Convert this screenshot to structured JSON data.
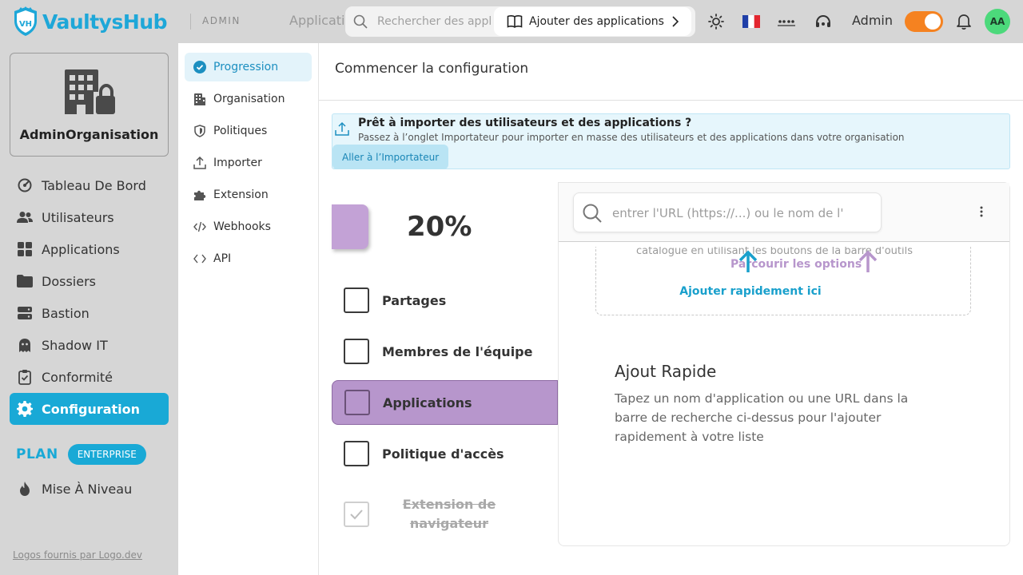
{
  "app": {
    "name": "VaultysHub",
    "logo_initials": "VH",
    "section": "ADMIN",
    "nav_ghost": "Applicati"
  },
  "topbar": {
    "search_placeholder": "Rechercher des appl",
    "add_apps_label": "Ajouter des applications",
    "user_name": "Admin",
    "avatar_initials": "AA",
    "flag": "🇫🇷"
  },
  "org": {
    "name": "AdminOrganisation"
  },
  "sidebar": {
    "items": [
      {
        "label": "Tableau De Bord",
        "icon": "dashboard-icon"
      },
      {
        "label": "Utilisateurs",
        "icon": "users-icon"
      },
      {
        "label": "Applications",
        "icon": "grid-icon"
      },
      {
        "label": "Dossiers",
        "icon": "folder-icon"
      },
      {
        "label": "Bastion",
        "icon": "server-icon"
      },
      {
        "label": "Shadow IT",
        "icon": "ghost-icon"
      },
      {
        "label": "Conformité",
        "icon": "clipboard-icon"
      },
      {
        "label": "Configuration",
        "icon": "gear-icon",
        "active": true
      }
    ],
    "plan_label": "PLAN",
    "plan_badge": "ENTERPRISE",
    "upgrade_label": "Mise À Niveau",
    "footer_link": "Logos fournis par Logo.dev"
  },
  "subnav": {
    "items": [
      {
        "label": "Progression",
        "icon": "check-circle-icon",
        "active": true
      },
      {
        "label": "Organisation",
        "icon": "building-icon"
      },
      {
        "label": "Politiques",
        "icon": "shield-icon"
      },
      {
        "label": "Importer",
        "icon": "upload-icon"
      },
      {
        "label": "Extension",
        "icon": "puzzle-icon"
      },
      {
        "label": "Webhooks",
        "icon": "code-icon"
      },
      {
        "label": "API",
        "icon": "brackets-icon"
      }
    ]
  },
  "main": {
    "title": "Commencer la configuration",
    "banner": {
      "title": "Prêt à importer des utilisateurs et des applications ?",
      "text": "Passez à l’onglet Importateur pour importer en masse des utilisateurs et des applications dans votre organisation",
      "button": "Aller à l’Importateur"
    },
    "progress_percent": 20,
    "progress_text": "20%",
    "steps": [
      {
        "label": "Partages",
        "state": "todo"
      },
      {
        "label": "Membres de l'équipe",
        "state": "todo"
      },
      {
        "label": "Applications",
        "state": "active"
      },
      {
        "label": "Politique d'accès",
        "state": "todo"
      },
      {
        "label": "Extension de navigateur",
        "state": "done"
      }
    ],
    "panel": {
      "url_placeholder": "entrer l'URL (https://...) ou le nom de l'",
      "dropzone_cut_text": "catalogue en utilisant les boutons de la barre d'outils",
      "browse_label": "Parcourir les options",
      "quick_add_label": "Ajouter rapidement ici",
      "quick_title": "Ajout Rapide",
      "quick_text": "Tapez un nom d'application ou une URL dans la barre de recherche ci-dessus pour l'ajouter rapidement à votre liste"
    }
  },
  "colors": {
    "brand": "#1ea7d8",
    "accent": "#19a9d6",
    "purple": "#b796cc",
    "toggle": "#f58220",
    "avatar": "#4cd97b"
  }
}
